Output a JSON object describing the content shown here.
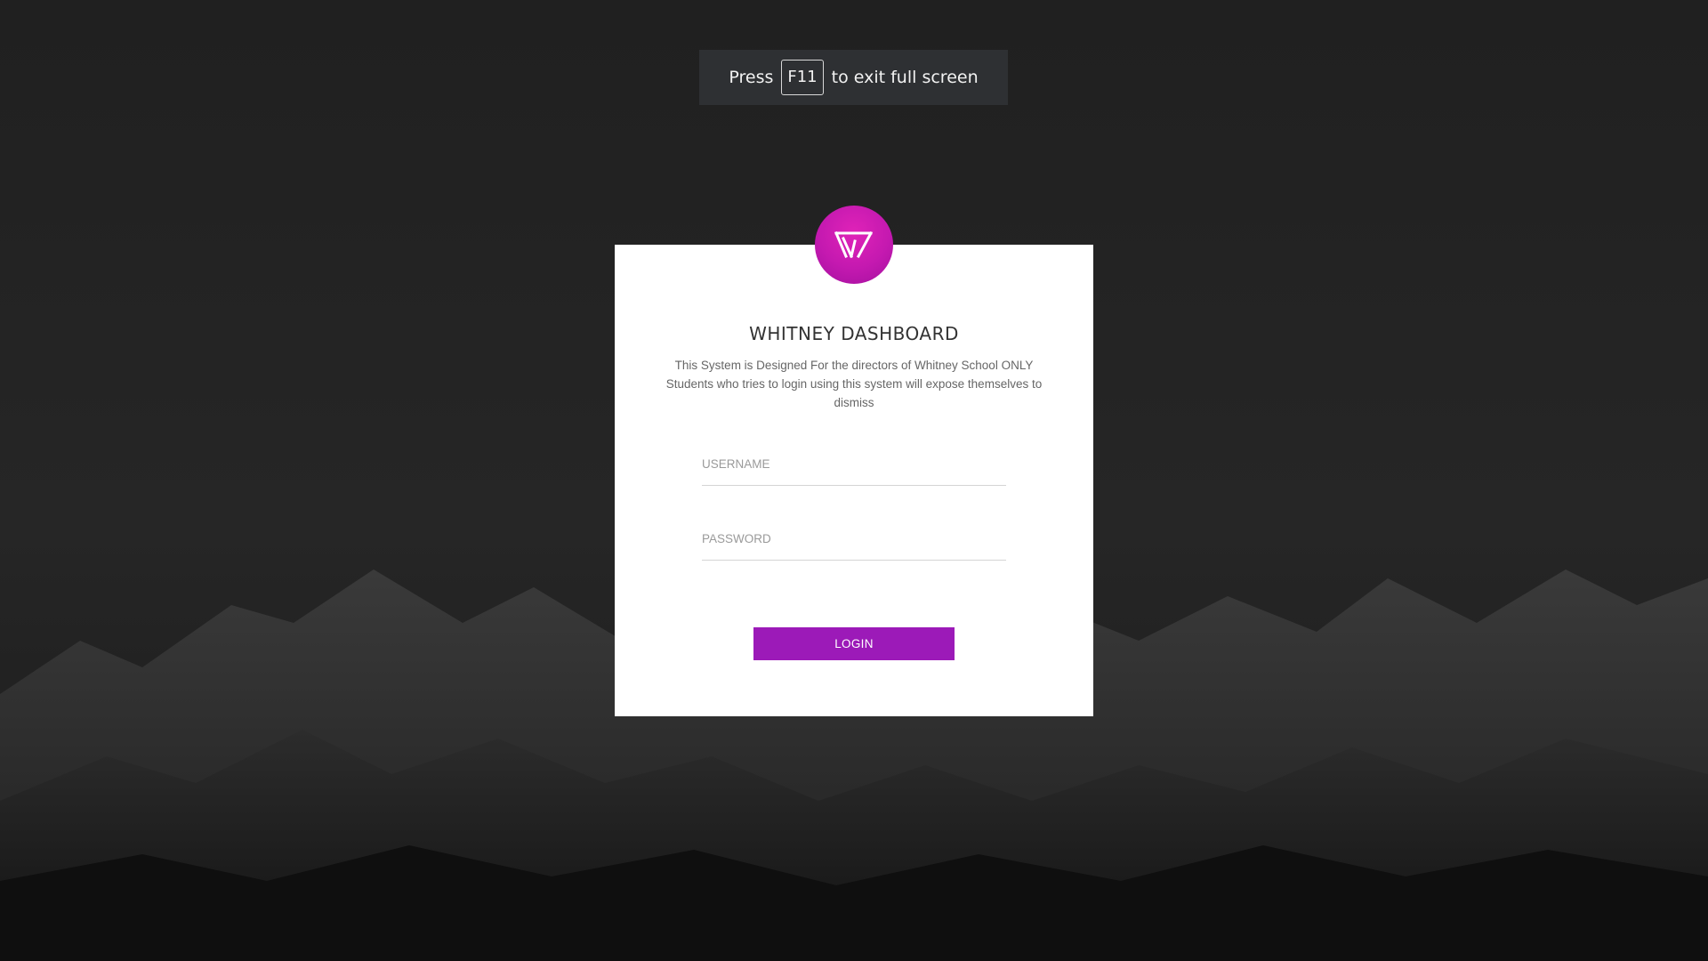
{
  "fullscreen_notice": {
    "prefix": "Press",
    "key": "F11",
    "suffix": "to exit full screen"
  },
  "login": {
    "logo_icon": "w-logo-icon",
    "title": "WHITNEY DASHBOARD",
    "description": "This System is Designed For the directors of Whitney School ONLY Students who tries to login using this system will expose themselves to dismiss",
    "username_placeholder": "USERNAME",
    "password_placeholder": "PASSWORD",
    "button_label": "LOGIN"
  },
  "colors": {
    "background": "#222222",
    "accent": "#9c1ab8",
    "logo": "#c419b0"
  }
}
